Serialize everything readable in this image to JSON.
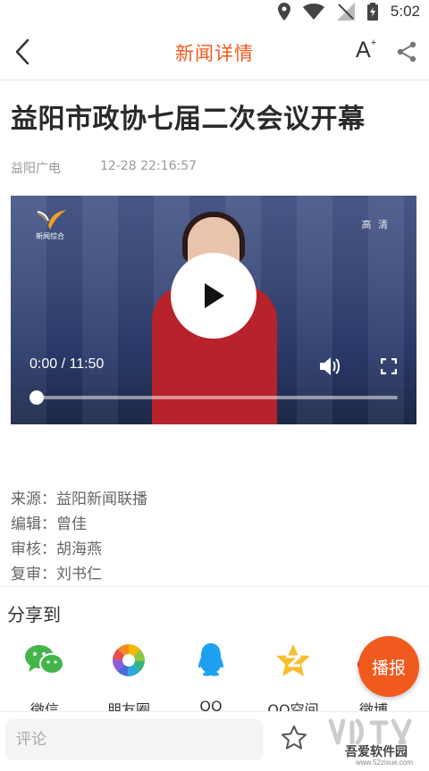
{
  "status_bar": {
    "time": "5:02"
  },
  "nav": {
    "title": "新闻详情",
    "font_button": "A",
    "font_sup": "+"
  },
  "article": {
    "headline": "益阳市政协七届二次会议开幕",
    "source_name": "益阳广电",
    "timestamp": "12-28 22:16:57"
  },
  "video": {
    "channel_logo_text": "新闻综合",
    "hd_badge": "高 清",
    "timecode": "0:00 / 11:50",
    "progress": 0.0
  },
  "credits": [
    {
      "label": "来源：",
      "value": "益阳新闻联播"
    },
    {
      "label": "编辑：",
      "value": "曾佳"
    },
    {
      "label": "审核：",
      "value": "胡海燕"
    },
    {
      "label": "复审：",
      "value": "刘书仁"
    }
  ],
  "share": {
    "title": "分享到",
    "items": [
      {
        "label": "微信",
        "icon": "wechat-icon"
      },
      {
        "label": "朋友圈",
        "icon": "moments-icon"
      },
      {
        "label": "QQ",
        "icon": "qq-icon"
      },
      {
        "label": "QQ空间",
        "icon": "qzone-icon"
      },
      {
        "label": "微博",
        "icon": "weibo-icon"
      }
    ]
  },
  "broadcast_button": "播报",
  "comment": {
    "placeholder": "评论"
  },
  "watermark": {
    "main": "吾爱软件园",
    "url": "www.52zixue.com"
  },
  "colors": {
    "accent": "#f05a1e",
    "video_red": "#b8222a"
  }
}
